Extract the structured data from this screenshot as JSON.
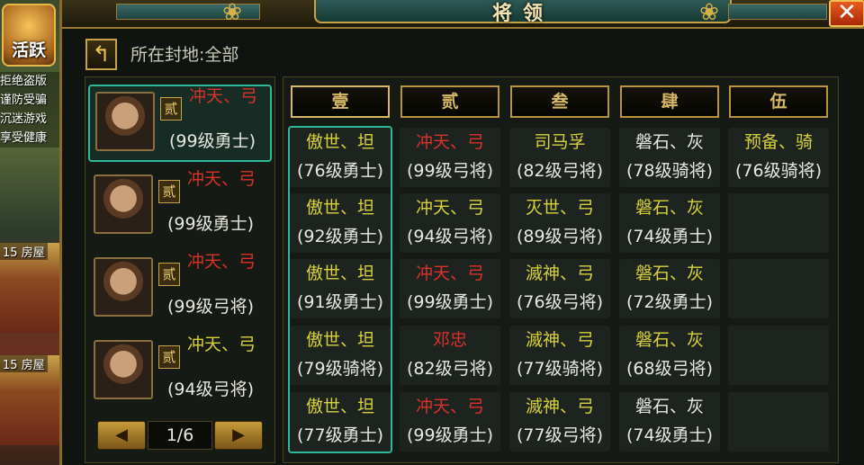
{
  "colors": {
    "yellow": "#d7d23c",
    "red": "#d8322a",
    "white": "#e8e8e0",
    "teal_select": "#2fb79a",
    "gold": "#c8a24a"
  },
  "sidebar": {
    "activity_label": "活跃",
    "notice_lines": [
      "拒绝盗版",
      "谨防受骗",
      "沉迷游戏",
      "享受健康"
    ],
    "houses": [
      {
        "badge": "15",
        "label": "房屋"
      },
      {
        "badge": "15",
        "label": "房屋"
      }
    ]
  },
  "window": {
    "title": "将领",
    "close_icon": "close-icon"
  },
  "fief_filter": {
    "label": "所在封地:全部"
  },
  "generals": [
    {
      "name": "冲天、弓",
      "name_color": "red",
      "rank": "贰",
      "level": "(99级勇士)",
      "selected": true
    },
    {
      "name": "冲天、弓",
      "name_color": "red",
      "rank": "贰",
      "level": "(99级勇士)",
      "selected": false
    },
    {
      "name": "冲天、弓",
      "name_color": "red",
      "rank": "贰",
      "level": "(99级弓将)",
      "selected": false
    },
    {
      "name": "冲天、弓",
      "name_color": "yellow",
      "rank": "贰",
      "level": "(94级弓将)",
      "selected": false
    }
  ],
  "pager": {
    "prev_icon": "arrow-left-icon",
    "next_icon": "arrow-right-icon",
    "page": "1/6"
  },
  "columns": [
    "壹",
    "贰",
    "叁",
    "肆",
    "伍"
  ],
  "grid": [
    [
      {
        "name": "傲世、坦",
        "color": "yellow",
        "level": "(76级勇士)"
      },
      {
        "name": "冲天、弓",
        "color": "red",
        "level": "(99级弓将)"
      },
      {
        "name": "司马孚",
        "color": "yellow",
        "level": "(82级弓将)"
      },
      {
        "name": "磐石、灰",
        "color": "white",
        "level": "(78级骑将)"
      },
      {
        "name": "预备、骑",
        "color": "yellow",
        "level": "(76级骑将)"
      }
    ],
    [
      {
        "name": "傲世、坦",
        "color": "yellow",
        "level": "(92级勇士)"
      },
      {
        "name": "冲天、弓",
        "color": "yellow",
        "level": "(94级弓将)"
      },
      {
        "name": "灭世、弓",
        "color": "yellow",
        "level": "(89级弓将)"
      },
      {
        "name": "磐石、灰",
        "color": "yellow",
        "level": "(74级勇士)"
      },
      null
    ],
    [
      {
        "name": "傲世、坦",
        "color": "yellow",
        "level": "(91级勇士)"
      },
      {
        "name": "冲天、弓",
        "color": "red",
        "level": "(99级勇士)"
      },
      {
        "name": "滅神、弓",
        "color": "yellow",
        "level": "(76级弓将)"
      },
      {
        "name": "磐石、灰",
        "color": "yellow",
        "level": "(72级勇士)"
      },
      null
    ],
    [
      {
        "name": "傲世、坦",
        "color": "yellow",
        "level": "(79级骑将)"
      },
      {
        "name": "邓忠",
        "color": "red",
        "level": "(82级弓将)"
      },
      {
        "name": "滅神、弓",
        "color": "yellow",
        "level": "(77级骑将)"
      },
      {
        "name": "磐石、灰",
        "color": "yellow",
        "level": "(68级弓将)"
      },
      null
    ],
    [
      {
        "name": "傲世、坦",
        "color": "yellow",
        "level": "(77级勇士)"
      },
      {
        "name": "冲天、弓",
        "color": "red",
        "level": "(99级勇士)"
      },
      {
        "name": "滅神、弓",
        "color": "yellow",
        "level": "(77级弓将)"
      },
      {
        "name": "磐石、灰",
        "color": "white",
        "level": "(74级勇士)"
      },
      null
    ]
  ]
}
